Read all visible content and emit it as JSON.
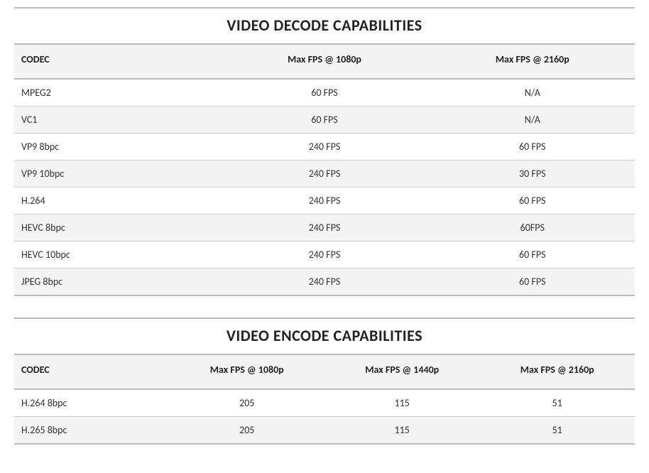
{
  "decode": {
    "title": "VIDEO DECODE CAPABILITIES",
    "headers": [
      "CODEC",
      "Max FPS @ 1080p",
      "Max FPS @ 2160p"
    ],
    "rows": [
      {
        "codec": "MPEG2",
        "fps1080": "60 FPS",
        "fps2160": "N/A"
      },
      {
        "codec": "VC1",
        "fps1080": "60 FPS",
        "fps2160": "N/A"
      },
      {
        "codec": "VP9 8bpc",
        "fps1080": "240 FPS",
        "fps2160": "60 FPS"
      },
      {
        "codec": "VP9 10bpc",
        "fps1080": "240 FPS",
        "fps2160": "30 FPS"
      },
      {
        "codec": "H.264",
        "fps1080": "240 FPS",
        "fps2160": "60 FPS"
      },
      {
        "codec": "HEVC 8bpc",
        "fps1080": "240 FPS",
        "fps2160": "60FPS"
      },
      {
        "codec": "HEVC 10bpc",
        "fps1080": "240 FPS",
        "fps2160": "60 FPS"
      },
      {
        "codec": "JPEG 8bpc",
        "fps1080": "240 FPS",
        "fps2160": "60 FPS"
      }
    ]
  },
  "encode": {
    "title": "VIDEO ENCODE CAPABILITIES",
    "headers": [
      "CODEC",
      "Max FPS @ 1080p",
      "Max FPS @ 1440p",
      "Max FPS @ 2160p"
    ],
    "rows": [
      {
        "codec": "H.264 8bpc",
        "fps1080": "205",
        "fps1440": "115",
        "fps2160": "51"
      },
      {
        "codec": "H.265 8bpc",
        "fps1080": "205",
        "fps1440": "115",
        "fps2160": "51"
      }
    ]
  },
  "chart_data": [
    {
      "type": "table",
      "title": "VIDEO DECODE CAPABILITIES",
      "columns": [
        "CODEC",
        "Max FPS @ 1080p",
        "Max FPS @ 2160p"
      ],
      "rows": [
        [
          "MPEG2",
          "60 FPS",
          "N/A"
        ],
        [
          "VC1",
          "60 FPS",
          "N/A"
        ],
        [
          "VP9 8bpc",
          "240 FPS",
          "60 FPS"
        ],
        [
          "VP9 10bpc",
          "240 FPS",
          "30 FPS"
        ],
        [
          "H.264",
          "240 FPS",
          "60 FPS"
        ],
        [
          "HEVC 8bpc",
          "240 FPS",
          "60FPS"
        ],
        [
          "HEVC 10bpc",
          "240 FPS",
          "60 FPS"
        ],
        [
          "JPEG 8bpc",
          "240 FPS",
          "60 FPS"
        ]
      ]
    },
    {
      "type": "table",
      "title": "VIDEO ENCODE CAPABILITIES",
      "columns": [
        "CODEC",
        "Max FPS @ 1080p",
        "Max FPS @ 1440p",
        "Max FPS @ 2160p"
      ],
      "rows": [
        [
          "H.264 8bpc",
          "205",
          "115",
          "51"
        ],
        [
          "H.265 8bpc",
          "205",
          "115",
          "51"
        ]
      ]
    }
  ]
}
